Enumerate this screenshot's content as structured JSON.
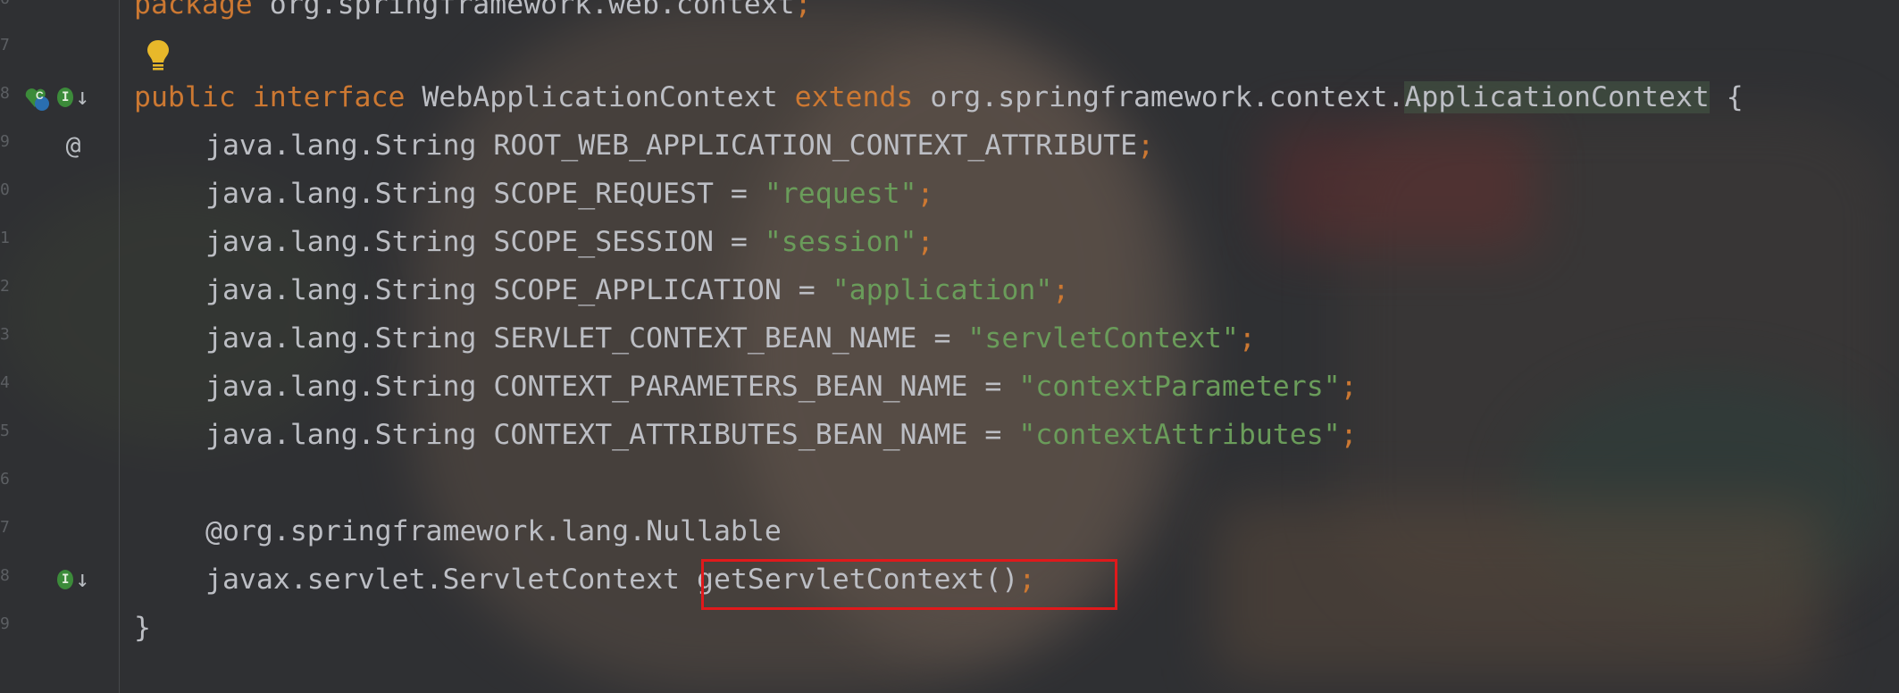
{
  "editor": {
    "gutter_line_numbers": [
      "6",
      "7",
      "8",
      "9",
      "0",
      "1",
      "2",
      "3",
      "4",
      "5",
      "6",
      "7",
      "8",
      "9"
    ],
    "gutter_icons": {
      "impl_badge": "I",
      "class_badge": "C",
      "at_symbol": "@"
    },
    "code_lines": {
      "l0": {
        "kw": "package",
        "text": " org.springframework.web.context",
        "end": ";"
      },
      "l2": {
        "kw1": "public",
        "kw2": "interface",
        "name": " WebApplicationContext ",
        "kw3": "extends",
        "pkg": " org.springframework.context.",
        "parent": "ApplicationContext",
        "brace": " {"
      },
      "l3": {
        "type": "java.lang.String ",
        "name": "ROOT_WEB_APPLICATION_CONTEXT_ATTRIBUTE",
        "end": ";"
      },
      "l4": {
        "type": "java.lang.String ",
        "name": "SCOPE_REQUEST = ",
        "value": "\"request\"",
        "end": ";"
      },
      "l5": {
        "type": "java.lang.String ",
        "name": "SCOPE_SESSION = ",
        "value": "\"session\"",
        "end": ";"
      },
      "l6": {
        "type": "java.lang.String ",
        "name": "SCOPE_APPLICATION = ",
        "value": "\"application\"",
        "end": ";"
      },
      "l7": {
        "type": "java.lang.String ",
        "name": "SERVLET_CONTEXT_BEAN_NAME = ",
        "value": "\"servletContext\"",
        "end": ";"
      },
      "l8": {
        "type": "java.lang.String ",
        "name": "CONTEXT_PARAMETERS_BEAN_NAME = ",
        "value": "\"contextParameters\"",
        "end": ";"
      },
      "l9": {
        "type": "java.lang.String ",
        "name": "CONTEXT_ATTRIBUTES_BEAN_NAME = ",
        "value": "\"contextAttributes\"",
        "end": ";"
      },
      "l11": {
        "annotation": "@org.springframework.lang.Nullable"
      },
      "l12": {
        "type": "javax.servlet.ServletContext ",
        "method": "getServletContext()",
        "end": ";"
      },
      "l13": {
        "brace": "}"
      }
    },
    "colors": {
      "keyword": "#cc7832",
      "string": "#6a9c5a",
      "text": "#bcbec4",
      "highlight_box": "#e0191b"
    }
  }
}
